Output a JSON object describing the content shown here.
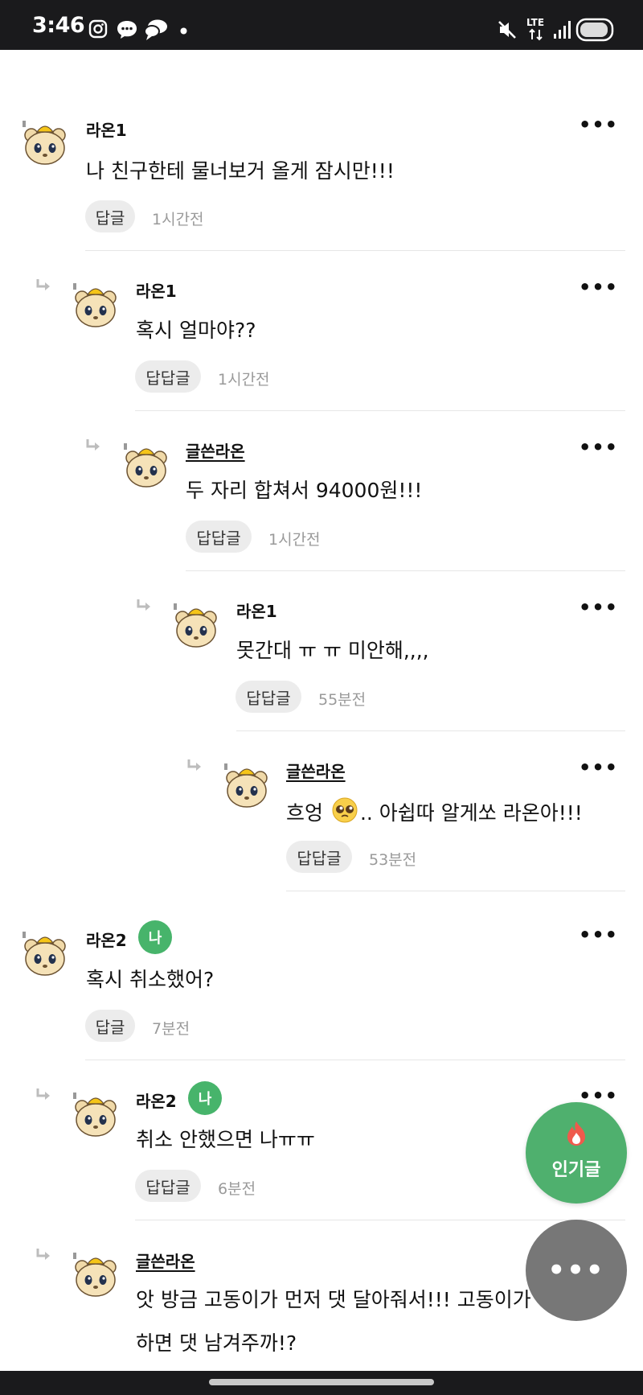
{
  "status_bar": {
    "time": "3:46",
    "network": "LTE",
    "icons": [
      "instagram-icon",
      "message-icon",
      "chat-bubbles-icon",
      "dot-icon",
      "mute-icon",
      "lte-icon",
      "signal-icon",
      "battery-icon"
    ]
  },
  "comments": [
    {
      "author": "라온1",
      "text": "나 친구한테 물너보거 올게 잠시만!!!",
      "reply_label": "답글",
      "time": "1시간전"
    },
    {
      "author": "라온1",
      "text": "혹시 얼마야??",
      "reply_label": "답답글",
      "time": "1시간전"
    },
    {
      "author": "글쓴라온",
      "text": "두 자리 합쳐서 94000원!!!",
      "reply_label": "답답글",
      "time": "1시간전"
    },
    {
      "author": "라온1",
      "text": "못간대 ㅠ ㅠ 미안해,,,,",
      "reply_label": "답답글",
      "time": "55분전"
    },
    {
      "author": "글쓴라온",
      "text_before": "흐엉 ",
      "text_after": ".. 아쉽따 알게쏘 라온아!!!",
      "reply_label": "답답글",
      "time": "53분전"
    },
    {
      "author": "라온2",
      "badge": "나",
      "text": "혹시 취소했어?",
      "reply_label": "답글",
      "time": "7분전"
    },
    {
      "author": "라온2",
      "badge": "나",
      "text": "취소 안했으면 나ㅠㅠ",
      "reply_label": "답답글",
      "time": "6분전"
    },
    {
      "author": "글쓴라온",
      "text": "앗 방금 고동이가 먼저 댓 달아줘서!!! 고동이가",
      "text_line2": "하면 댓 남겨주까!?"
    }
  ],
  "more_label": "•••",
  "fab": {
    "popular_label": "인기글",
    "more_label": "•••"
  },
  "colors": {
    "badge": "#47b46b",
    "fab_popular": "#4fb06e",
    "fab_more": "#777777",
    "reply_pill": "#ececec"
  }
}
